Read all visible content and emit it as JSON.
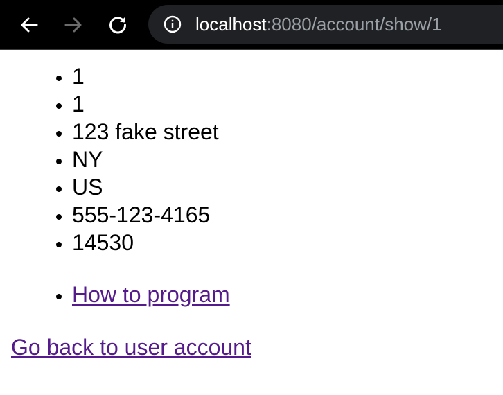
{
  "browser": {
    "url_host": "localhost",
    "url_rest": ":8080/account/show/1",
    "icons": {
      "back": "arrow-left-icon",
      "forward": "arrow-right-icon",
      "reload": "reload-icon",
      "info": "info-icon"
    },
    "colors": {
      "toolbar_bg": "#000000",
      "omnibox_bg": "#202124",
      "url_host": "#ffffff",
      "url_rest": "#9aa0a6"
    }
  },
  "account_details": [
    "1",
    "1",
    "123 fake street",
    "NY",
    "US",
    "555-123-4165",
    "14530"
  ],
  "links": [
    {
      "label": "How to program"
    }
  ],
  "back_link": {
    "label": "Go back to user account"
  },
  "colors": {
    "link": "#551a8b",
    "text": "#000000"
  }
}
